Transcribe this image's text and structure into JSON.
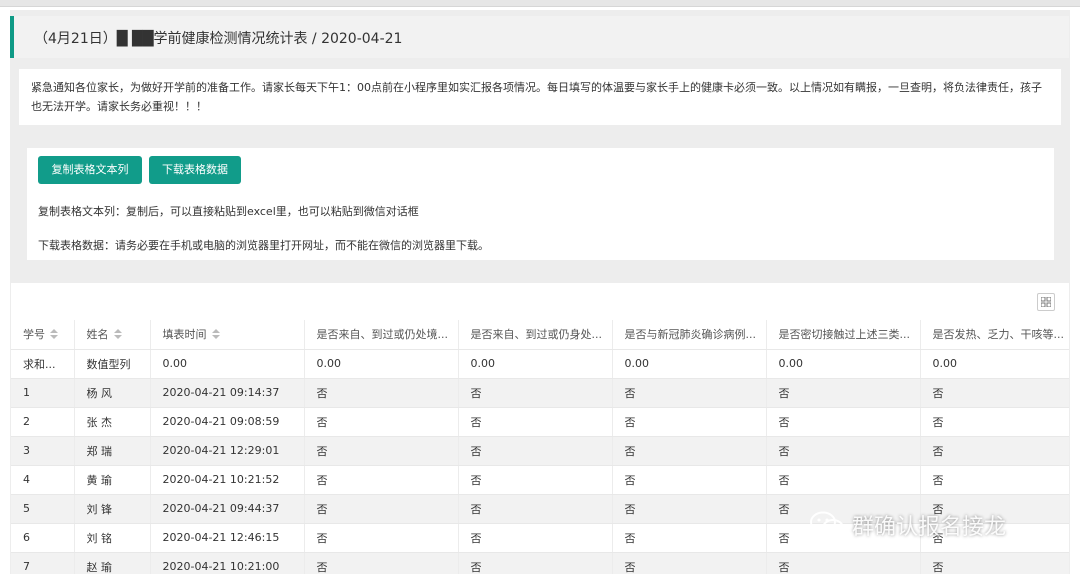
{
  "header": {
    "title": "（4月21日）█ ██学前健康检测情况统计表 / 2020-04-21"
  },
  "notice": {
    "text": "紧急通知各位家长，为做好开学前的准备工作。请家长每天下午1：00点前在小程序里如实汇报各项情况。每日填写的体温要与家长手上的健康卡必须一致。以上情况如有瞒报，一旦查明，将负法律责任，孩子也无法开学。请家长务必重视！！！"
  },
  "actions": {
    "copy_label": "复制表格文本列",
    "download_label": "下载表格数据",
    "copy_hint": "复制表格文本列：复制后，可以直接粘贴到excel里，也可以粘贴到微信对话框",
    "download_hint": "下载表格数据：请务必要在手机或电脑的浏览器里打开网址，而不能在微信的浏览器里下载。"
  },
  "table": {
    "columns": [
      "学号",
      "姓名",
      "填表时间",
      "是否来自、到过或仍处境...",
      "是否来自、到过或仍身处...",
      "是否与新冠肺炎确诊病例...",
      "是否密切接触过上述三类...",
      "是否发热、乏力、干咳等..."
    ],
    "summary": [
      "求和...",
      "数值型列",
      "0.00",
      "0.00",
      "0.00",
      "0.00",
      "0.00",
      "0.00"
    ],
    "rows": [
      [
        "1",
        "杨 风",
        "2020-04-21 09:14:37",
        "否",
        "否",
        "否",
        "否",
        "否"
      ],
      [
        "2",
        "张 杰",
        "2020-04-21 09:08:59",
        "否",
        "否",
        "否",
        "否",
        "否"
      ],
      [
        "3",
        "郑 瑞",
        "2020-04-21 12:29:01",
        "否",
        "否",
        "否",
        "否",
        "否"
      ],
      [
        "4",
        "黄 瑜",
        "2020-04-21 10:21:52",
        "否",
        "否",
        "否",
        "否",
        "否"
      ],
      [
        "5",
        "刘 锋",
        "2020-04-21 09:44:37",
        "否",
        "否",
        "否",
        "否",
        "否"
      ],
      [
        "6",
        "刘 铭",
        "2020-04-21 12:46:15",
        "否",
        "否",
        "否",
        "否",
        "否"
      ],
      [
        "7",
        "赵 瑜",
        "2020-04-21 10:21:00",
        "否",
        "否",
        "否",
        "否",
        "否"
      ]
    ]
  },
  "watermark": {
    "text": "群确认报名接龙"
  }
}
